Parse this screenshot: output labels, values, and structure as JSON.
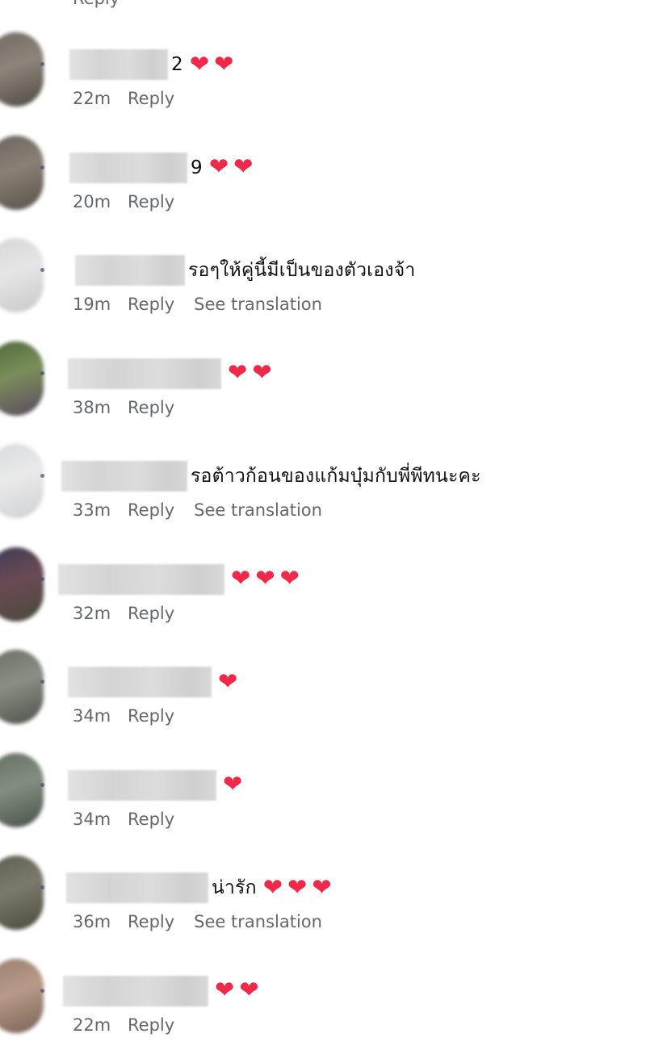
{
  "top_remnant": {
    "reply": "Reply"
  },
  "heart_glyph": "❤",
  "heart_color": "#f02849",
  "meta_color": "#65676b",
  "comments": [
    {
      "text": "2",
      "hearts": 2,
      "time": "22m",
      "reply": "Reply",
      "translation": ""
    },
    {
      "text": "9",
      "hearts": 2,
      "time": "20m",
      "reply": "Reply",
      "translation": ""
    },
    {
      "text": "รอๆให้คู่นี้มีเป็นของตัวเองจ้า",
      "hearts": 0,
      "time": "19m",
      "reply": "Reply",
      "translation": "See translation"
    },
    {
      "text": "",
      "hearts": 2,
      "time": "38m",
      "reply": "Reply",
      "translation": ""
    },
    {
      "text": "รอต้าวก้อนของแก้มบุ๋มกับพี่พีทนะคะ",
      "hearts": 0,
      "time": "33m",
      "reply": "Reply",
      "translation": "See translation"
    },
    {
      "text": "",
      "hearts": 3,
      "time": "32m",
      "reply": "Reply",
      "translation": ""
    },
    {
      "text": "",
      "hearts": 1,
      "time": "34m",
      "reply": "Reply",
      "translation": ""
    },
    {
      "text": "",
      "hearts": 1,
      "time": "34m",
      "reply": "Reply",
      "translation": ""
    },
    {
      "text": "น่ารัก",
      "hearts": 3,
      "time": "36m",
      "reply": "Reply",
      "translation": "See translation"
    },
    {
      "text": "",
      "hearts": 2,
      "time": "22m",
      "reply": "Reply",
      "translation": ""
    }
  ]
}
